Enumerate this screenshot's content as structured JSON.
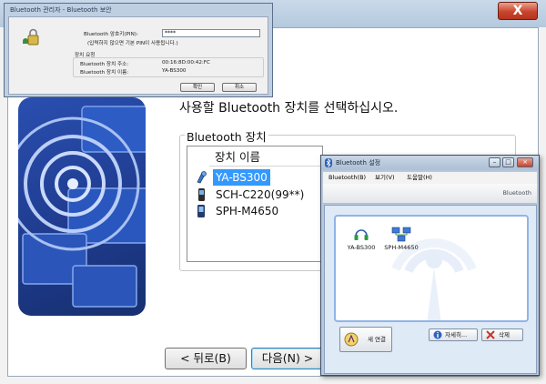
{
  "pin_dialog": {
    "title": "Bluetooth 관리자 - Bluetooth 보안",
    "pin_label": "Bluetooth 암호키(PIN):",
    "pin_value": "****",
    "pin_hint": "(입력하지 않으면 기본 PIN이 사용됩니다.)",
    "section_title": "장치 요청",
    "addr_label": "Bluetooth 장치 주소:",
    "addr_value": "00:16:8D:00:42:FC",
    "name_label": "Bluetooth 장치 이름:",
    "name_value": "YA-BS300",
    "ok_label": "확인",
    "cancel_label": "취소"
  },
  "wizard": {
    "close_label": "X",
    "heading": "사용할 Bluetooth 장치를 선택하십시오.",
    "group_label": "Bluetooth 장치",
    "column_header": "장치 이름",
    "devices": [
      {
        "name": "YA-BS300",
        "icon": "headset-icon",
        "selected": true
      },
      {
        "name": "SCH-C220(99**)",
        "icon": "phone-icon",
        "selected": false
      },
      {
        "name": "SPH-M4650",
        "icon": "phone-icon",
        "selected": false
      }
    ],
    "back_label": "< 뒤로(B)",
    "next_label": "다음(N) >"
  },
  "bt_settings": {
    "title": "Bluetooth 설정",
    "menu": [
      "Bluetooth(B)",
      "보기(V)",
      "도움말(H)"
    ],
    "brand": "Bluetooth",
    "devices": [
      {
        "name": "YA-BS300",
        "icon": "headset-icon"
      },
      {
        "name": "SPH-M4650",
        "icon": "network-icon"
      }
    ],
    "new_connection_label": "새 연결",
    "details_label": "자세히...",
    "delete_label": "삭제"
  },
  "colors": {
    "selection": "#3399ff",
    "art_blue": "#1e3a8c",
    "close_red": "#c8452d"
  }
}
